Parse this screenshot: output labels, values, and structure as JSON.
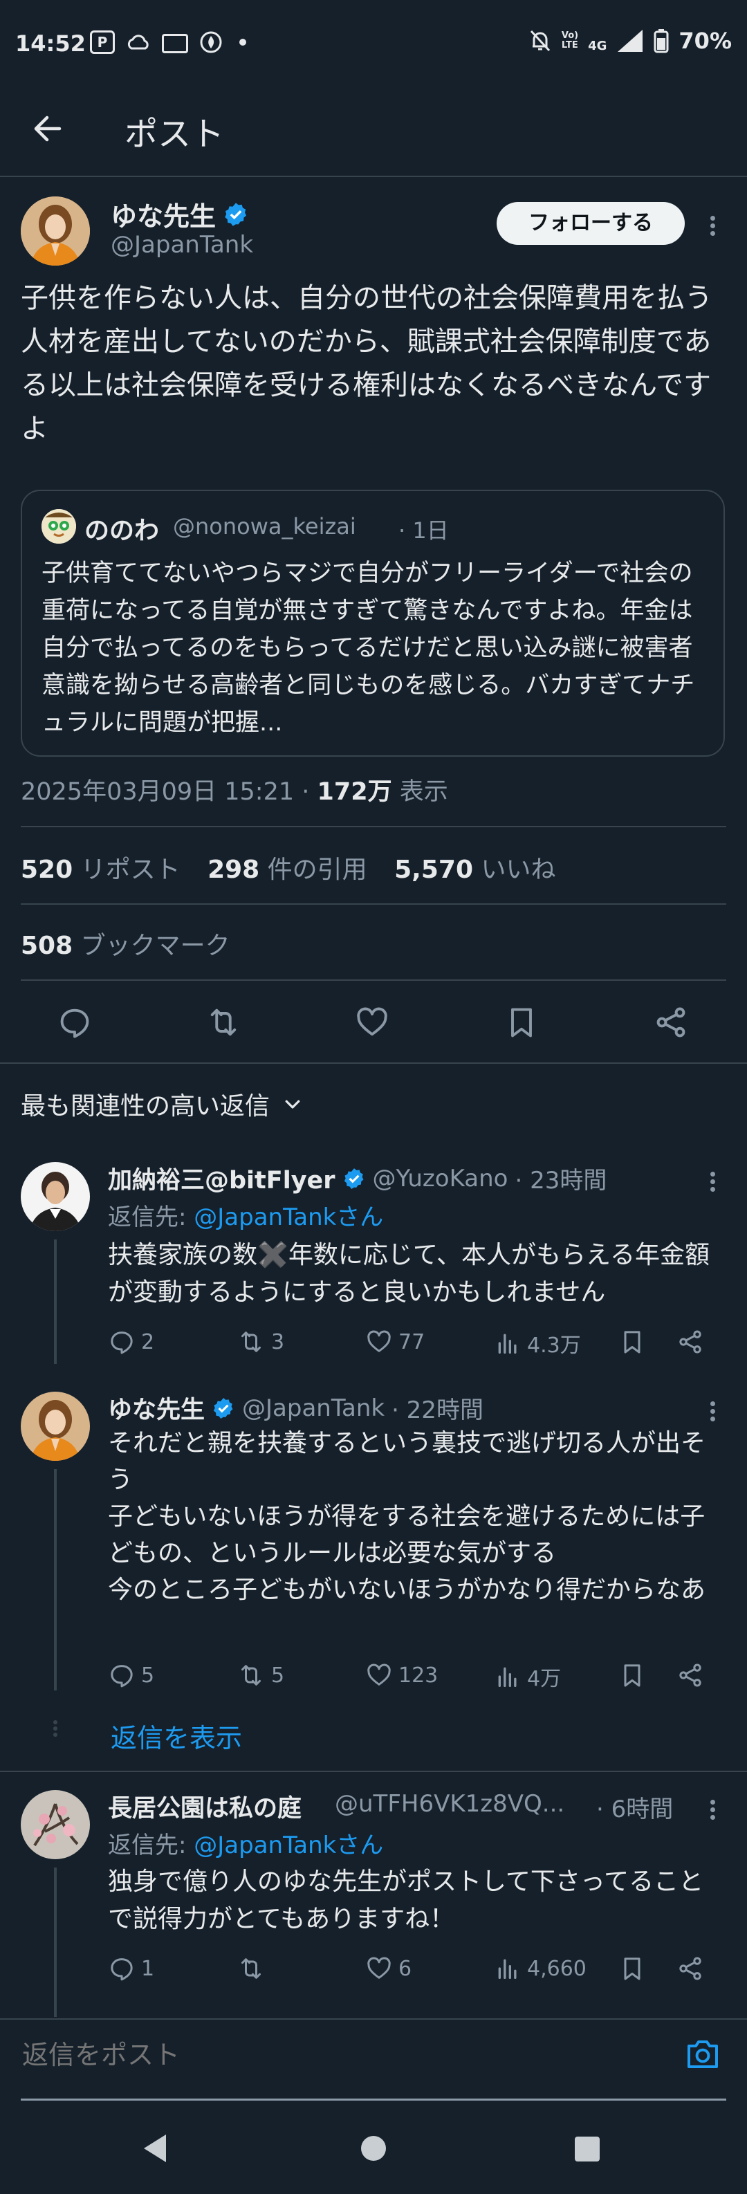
{
  "status_bar": {
    "time": "14:52",
    "battery": "70%",
    "network": "4G"
  },
  "header": {
    "title": "ポスト"
  },
  "post": {
    "author_name": "ゆな先生",
    "author_handle": "@JapanTank",
    "follow_label": "フォローする",
    "text": "子供を作らない人は、自分の世代の社会保障費用を払う人材を産出してないのだから、賦課式社会保障制度である以上は社会保障を受ける権利はなくなるべきなんですよ",
    "quote": {
      "author_name": "ののわ",
      "author_handle": "@nonowa_keizai",
      "time": "· 1日",
      "text": "子供育ててないやつらマジで自分がフリーライダーで社会の重荷になってる自覚が無さすぎて驚きなんですよね。年金は自分で払ってるのをもらってるだけだと思い込み謎に被害者意識を拗らせる高齢者と同じものを感じる。バカすぎてナチュラルに問題が把握..."
    },
    "timestamp": "2025年03月09日 15:21 · ",
    "views_count": "172万",
    "views_label": " 表示",
    "reposts_count": "520",
    "reposts_label": " リポスト",
    "quotes_count": "298",
    "quotes_label": " 件の引用",
    "likes_count": "5,570",
    "likes_label": " いいね",
    "bookmarks_count": "508",
    "bookmarks_label": " ブックマーク"
  },
  "sort": {
    "label": "最も関連性の高い返信"
  },
  "replies": [
    {
      "author_name": "加納裕三@bitFlyer",
      "author_handle": "@YuzoKano",
      "time": "· 23時間",
      "reply_to_prefix": "返信先: ",
      "reply_to": "@JapanTankさん",
      "text": "扶養家族の数✖️年数に応じて、本人がもらえる年金額が変動するようにすると良いかもしれません",
      "replies": "2",
      "reposts": "3",
      "likes": "77",
      "views": "4.3万"
    },
    {
      "author_name": "ゆな先生",
      "author_handle": "@JapanTank",
      "time": "· 22時間",
      "text": "それだと親を扶養するという裏技で逃げ切る人が出そう\n子どもいないほうが得をする社会を避けるためには子どもの、というルールは必要な気がする\n今のところ子どもがいないほうがかなり得だからなあ",
      "replies": "5",
      "reposts": "5",
      "likes": "123",
      "views": "4万",
      "show_replies": "返信を表示"
    },
    {
      "author_name": "長居公園は私の庭",
      "author_handle": "@uTFH6VK1z8VQ...",
      "time": "· 6時間",
      "reply_to_prefix": "返信先: ",
      "reply_to": "@JapanTankさん",
      "text": "独身で億り人のゆな先生がポストして下さってることで説得力がとてもありますね！",
      "replies": "1",
      "reposts": "",
      "likes": "6",
      "views": "4,660"
    }
  ],
  "composer": {
    "placeholder": "返信をポスト"
  },
  "colors": {
    "background": "#15202b",
    "accent": "#1d9bf0",
    "muted": "#8b98a5",
    "divider": "#38444d"
  }
}
